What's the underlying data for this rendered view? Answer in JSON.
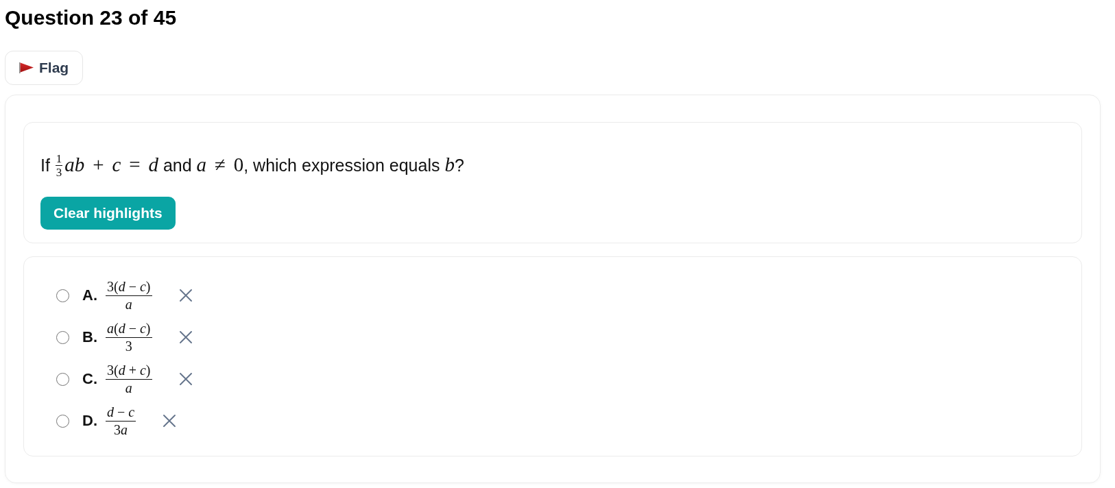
{
  "title": "Question 23 of 45",
  "flag_button": {
    "label": "Flag"
  },
  "question": {
    "segments": [
      {
        "kind": "text",
        "text": "If "
      },
      {
        "kind": "fraction",
        "numerator": "1",
        "denominator": "3"
      },
      {
        "kind": "math",
        "text": "ab + c = d"
      },
      {
        "kind": "text",
        "text": " and "
      },
      {
        "kind": "math",
        "text": "a ≠ 0"
      },
      {
        "kind": "text",
        "text": ", which expression equals "
      },
      {
        "kind": "math",
        "text": "b"
      },
      {
        "kind": "text",
        "text": "?"
      }
    ]
  },
  "clear_button": {
    "label": "Clear highlights"
  },
  "options": [
    {
      "letter": "A.",
      "numerator": "3(d−c)",
      "denominator": "a",
      "selected": false
    },
    {
      "letter": "B.",
      "numerator": "a(d−c)",
      "denominator": "3",
      "selected": false
    },
    {
      "letter": "C.",
      "numerator": "3(d+c)",
      "denominator": "a",
      "selected": false
    },
    {
      "letter": "D.",
      "numerator": "d−c",
      "denominator": "3a",
      "selected": false
    }
  ]
}
